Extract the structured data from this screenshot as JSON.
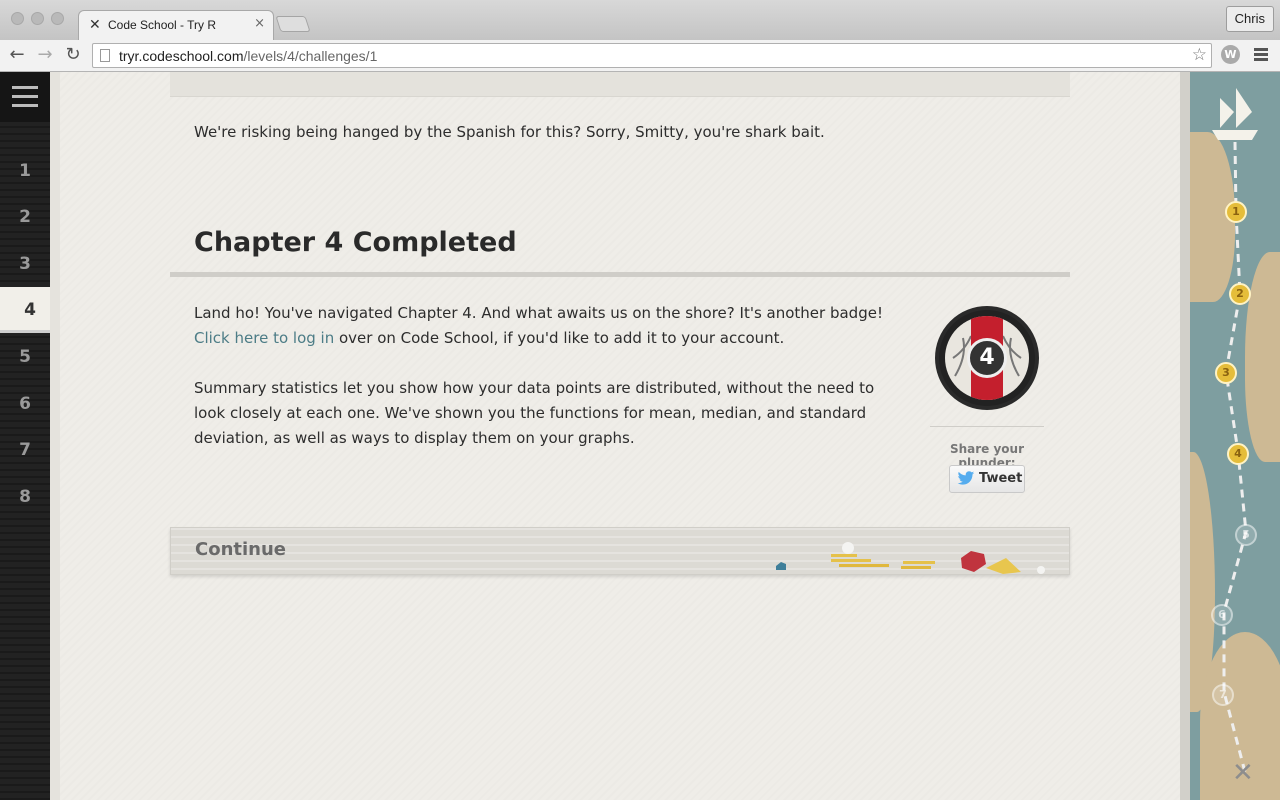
{
  "browser": {
    "tab_title": "Code School - Try R",
    "tab_close": "×",
    "profile": "Chris",
    "url_host": "tryr.codeschool.com",
    "url_path": "/levels/4/challenges/1",
    "back": "←",
    "forward": "→",
    "reload": "↻",
    "star": "☆",
    "ext": "W"
  },
  "sidebar": {
    "chapters": [
      "1",
      "2",
      "3",
      "4",
      "5",
      "6",
      "7",
      "8"
    ],
    "active": "4"
  },
  "content": {
    "quote": "We're risking being hanged by the Spanish for this? Sorry, Smitty, you're shark bait.",
    "chapter_title": "Chapter 4 Completed",
    "para1_line1": "Land ho! You've navigated Chapter 4. And what awaits us on the shore? It's another badge!",
    "login_link": "Click here to log in",
    "para1_line2_rest": " over on Code School, if you'd like to add it to your account.",
    "para2_line1": "Summary statistics let you show how your data points are distributed, without the need to",
    "para2_line2": "look closely at each one. We've shown you the functions for mean, median, and standard",
    "para2_line3": "deviation, as well as ways to display them on your graphs.",
    "continue": "Continue"
  },
  "badge": {
    "number": "4",
    "share_label": "Share your plunder:",
    "tweet": "Tweet"
  },
  "map": {
    "nodes_done": [
      "1",
      "2",
      "3",
      "4"
    ],
    "nodes_todo": [
      "5",
      "6",
      "7"
    ],
    "end_mark": "✕"
  },
  "colors": {
    "badge_red": "#c41f2d",
    "map_gold": "#e5bd3a",
    "link": "#4c7c86",
    "twitter": "#55acee"
  }
}
